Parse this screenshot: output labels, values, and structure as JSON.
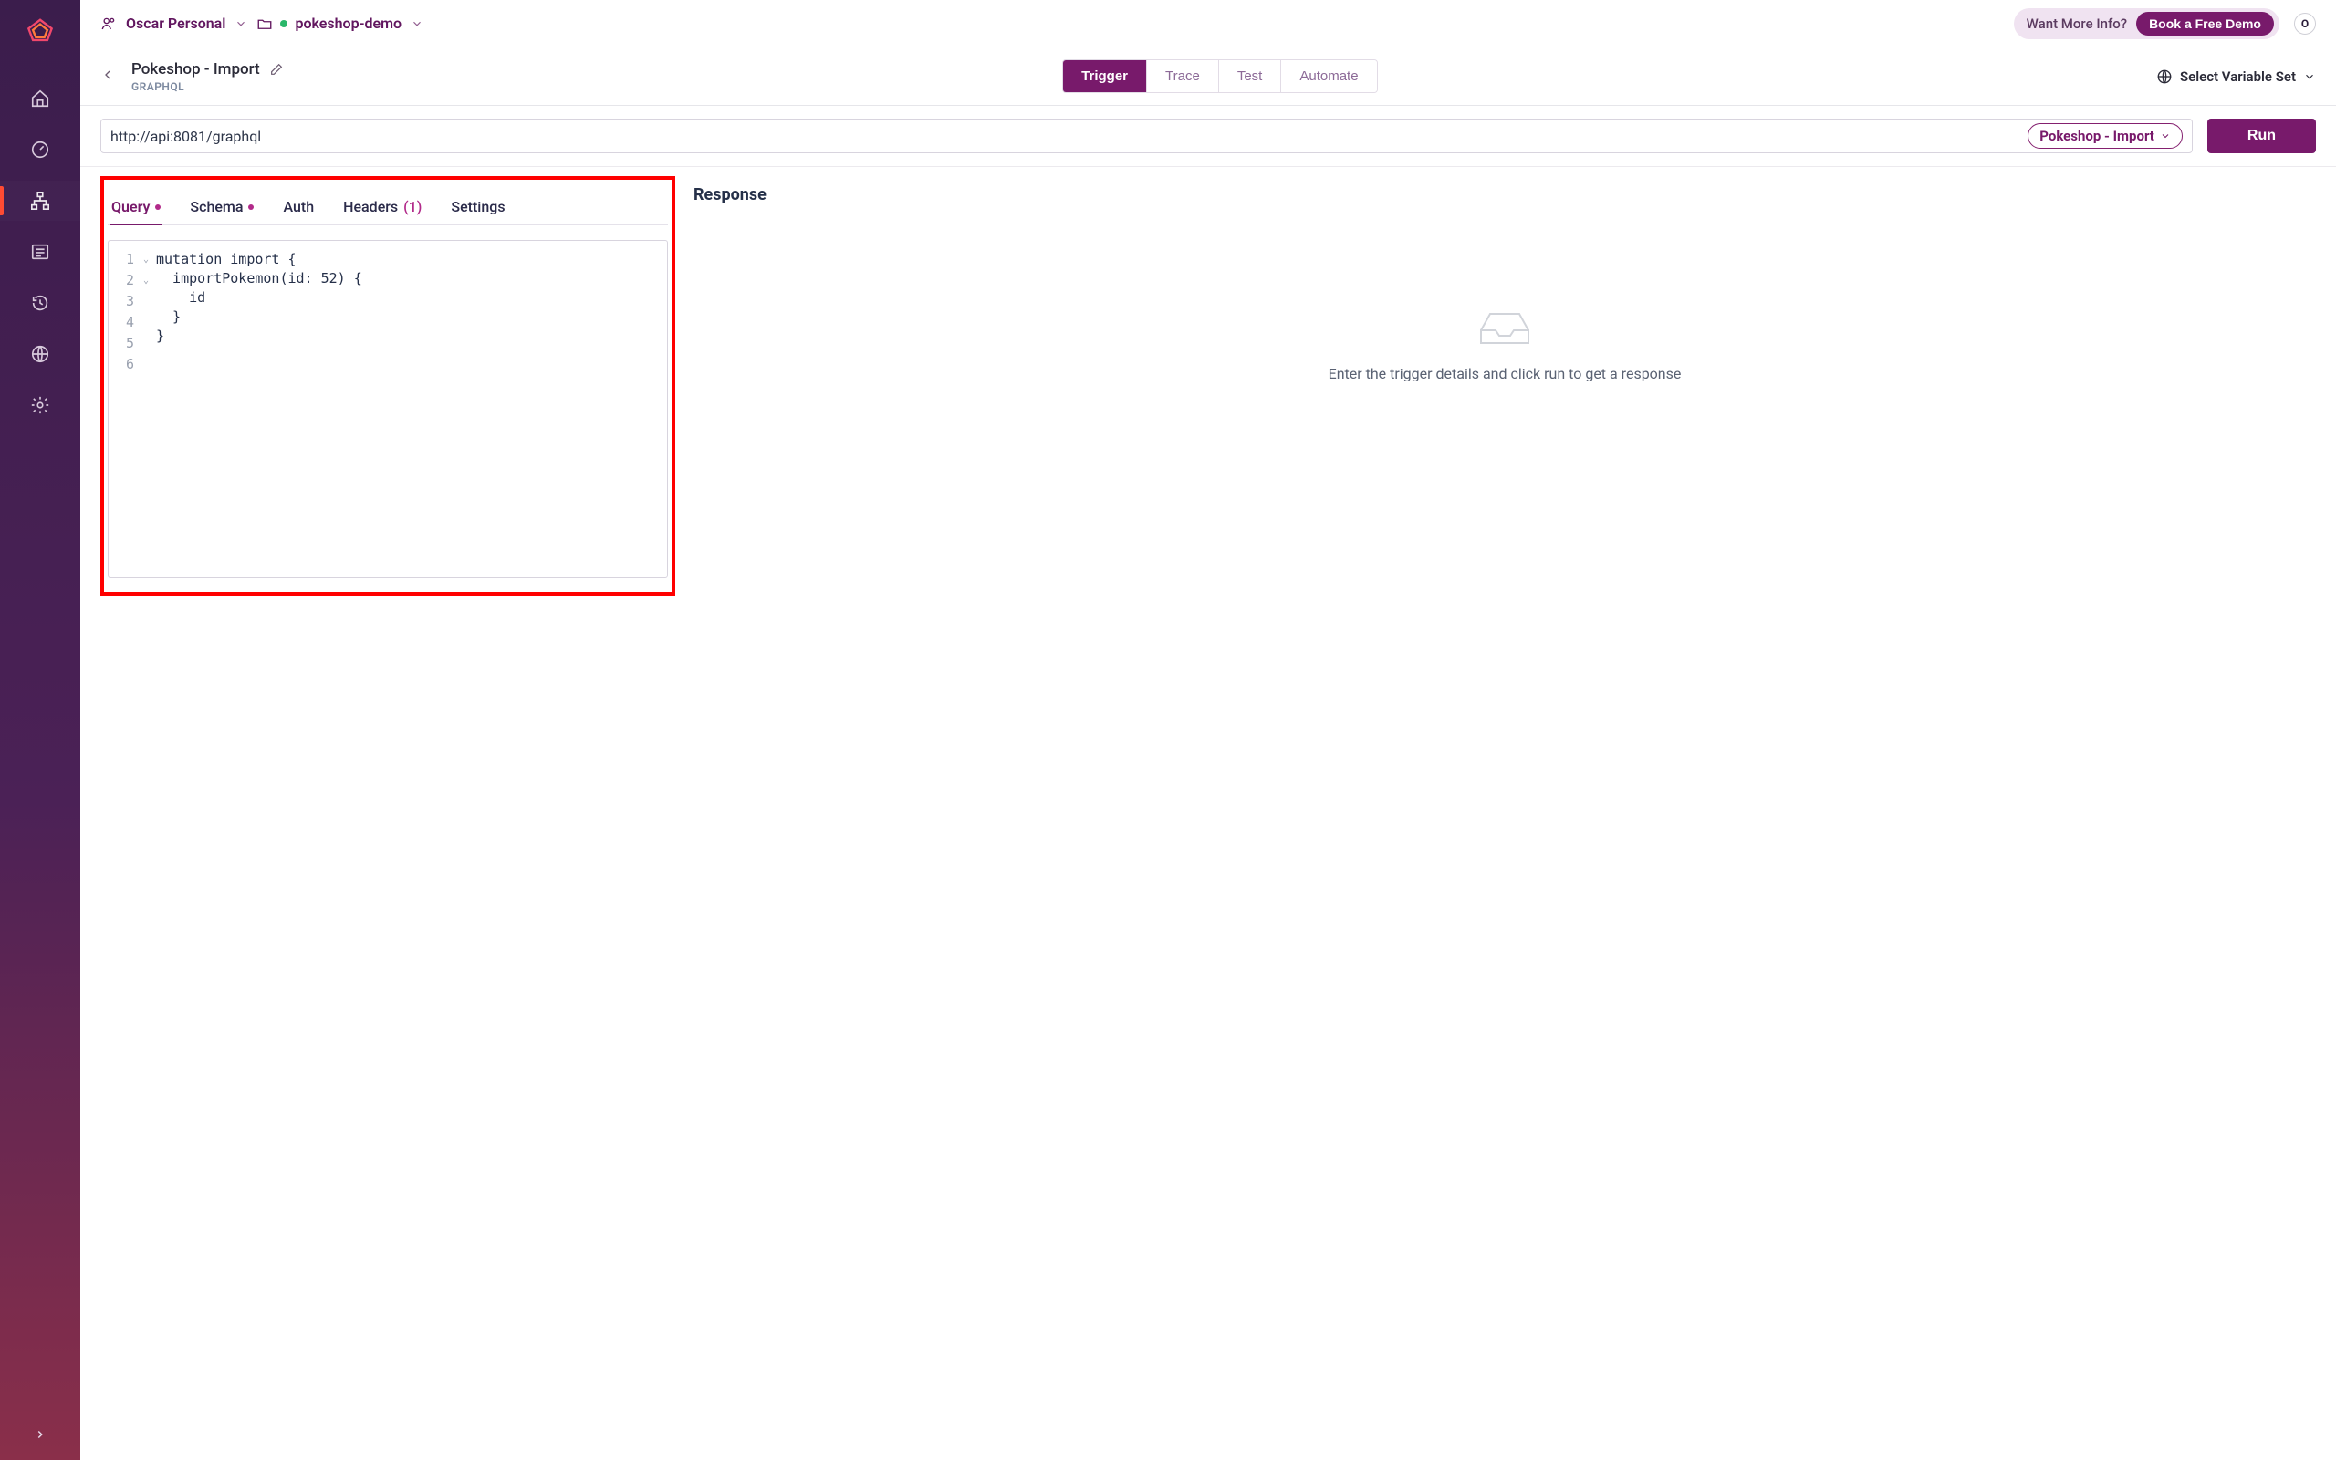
{
  "sidebar": {},
  "topbar": {
    "workspace_name": "Oscar Personal",
    "project_name": "pokeshop-demo",
    "info_text": "Want More Info?",
    "demo_button": "Book a Free Demo",
    "avatar_initial": "O"
  },
  "subheader": {
    "test_name": "Pokeshop - Import",
    "test_type": "GRAPHQL",
    "tabs": [
      "Trigger",
      "Trace",
      "Test",
      "Automate"
    ],
    "active_tab": "Trigger",
    "variable_set_label": "Select Variable Set"
  },
  "url_row": {
    "url": "http://api:8081/graphql",
    "env_label": "Pokeshop - Import",
    "run_button": "Run"
  },
  "editor": {
    "tabs": {
      "query_label": "Query",
      "schema_label": "Schema",
      "auth_label": "Auth",
      "headers_label": "Headers",
      "headers_count": "(1)",
      "settings_label": "Settings"
    },
    "line_numbers": [
      "1",
      "2",
      "3",
      "4",
      "5",
      "6"
    ],
    "code_lines": [
      "mutation import {",
      "  importPokemon(id: 52) {",
      "    id",
      "  }",
      "}",
      ""
    ]
  },
  "response": {
    "title": "Response",
    "empty_text": "Enter the trigger details and click run to get a response"
  }
}
